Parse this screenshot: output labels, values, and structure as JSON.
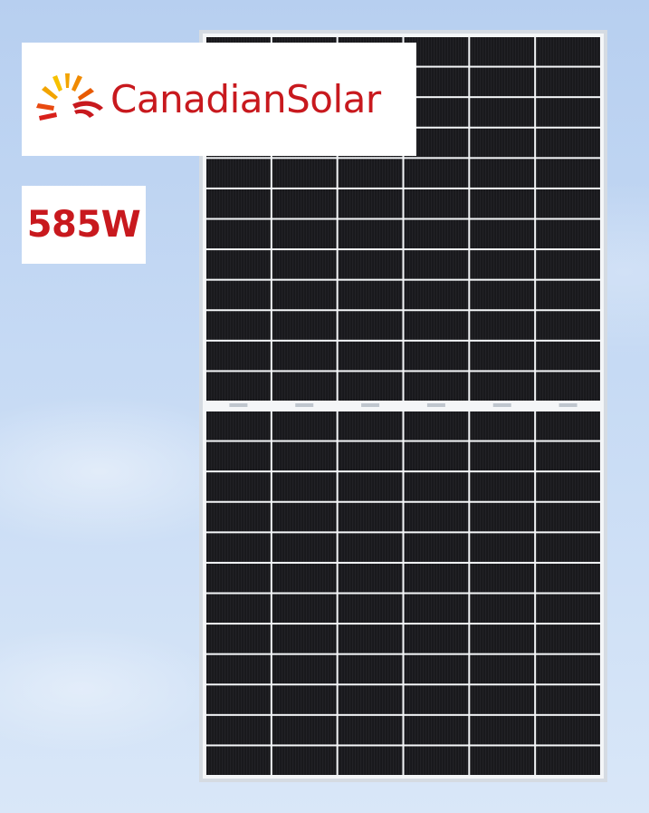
{
  "brand": {
    "name": "CanadianSolar",
    "color": "#c8191e"
  },
  "product": {
    "power": "585W"
  },
  "panel": {
    "frame_color": "#e8ecf0",
    "cell_color": "#141416",
    "columns": 6,
    "rows_per_half": 12,
    "halves": 2
  },
  "icons": {
    "logo": "sunburst-logo-icon"
  }
}
